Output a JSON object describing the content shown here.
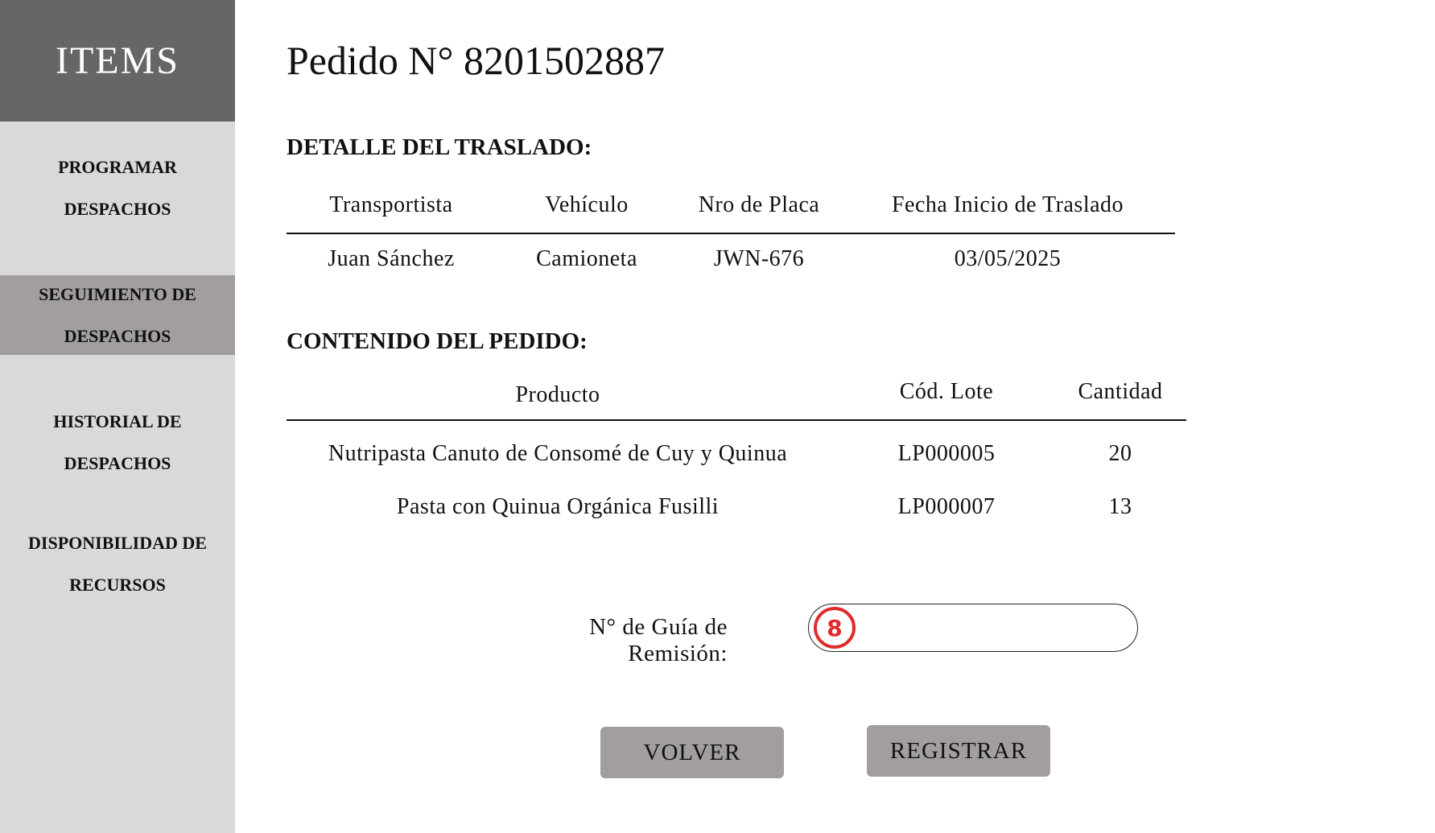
{
  "sidebar": {
    "header": "ITEMS",
    "items": [
      {
        "line1": "PROGRAMAR",
        "line2": "DESPACHOS"
      },
      {
        "line1": "SEGUIMIENTO DE",
        "line2": "DESPACHOS"
      },
      {
        "line1": "HISTORIAL DE",
        "line2": "DESPACHOS"
      },
      {
        "line1": "DISPONIBILIDAD DE",
        "line2": "RECURSOS"
      }
    ]
  },
  "page": {
    "title": "Pedido N° 8201502887"
  },
  "transfer": {
    "title": "DETALLE DEL TRASLADO:",
    "headers": [
      "Transportista",
      "Vehículo",
      "Nro de Placa",
      "Fecha Inicio de Traslado"
    ],
    "row": [
      "Juan Sánchez",
      "Camioneta",
      "JWN-676",
      "03/05/2025"
    ]
  },
  "contents": {
    "title": "CONTENIDO DEL PEDIDO:",
    "headers": [
      "Producto",
      "Cód. Lote",
      "Cantidad"
    ],
    "rows": [
      [
        "Nutripasta Canuto de Consomé de Cuy y Quinua",
        "LP000005",
        "20"
      ],
      [
        "Pasta con Quinua Orgánica Fusilli",
        "LP000007",
        "13"
      ]
    ]
  },
  "guide": {
    "label": "N° de Guía de Remisión:",
    "value": "",
    "step_badge": "8"
  },
  "buttons": {
    "back": "VOLVER",
    "register": "REGISTRAR"
  },
  "colors": {
    "sidebar_bg": "#d9d9d9",
    "header_bg": "#666666",
    "active_bg": "#a29e9e",
    "badge": "#e02b2b"
  }
}
